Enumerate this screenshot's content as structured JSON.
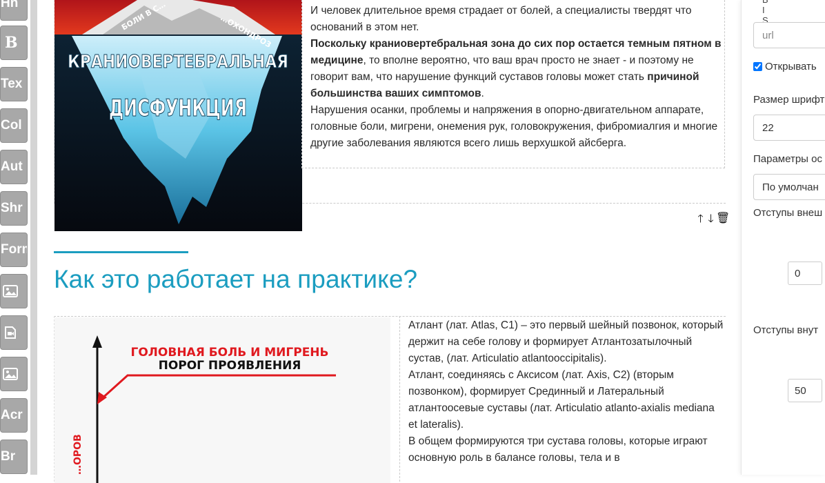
{
  "tools": [
    {
      "label": "Hn",
      "kind": "text"
    },
    {
      "label": "B",
      "kind": "serif"
    },
    {
      "label": "Tex",
      "kind": "text"
    },
    {
      "label": "Col",
      "kind": "text"
    },
    {
      "label": "Aut",
      "kind": "text"
    },
    {
      "label": "Shr",
      "kind": "text"
    },
    {
      "label": "Form",
      "kind": "text"
    },
    {
      "label": "",
      "kind": "image-icon"
    },
    {
      "label": "",
      "kind": "video-icon"
    },
    {
      "label": "",
      "kind": "image-icon"
    },
    {
      "label": "Acr",
      "kind": "text"
    },
    {
      "label": "Br",
      "kind": "text"
    }
  ],
  "block1": {
    "image_caption_top": "БОЛИ В С…",
    "image_caption_top2": "…ОХОНДРОЗ",
    "image_title_line1": "КРАНИОВЕРТЕБРАЛЬНАЯ",
    "image_title_line2": "ДИСФУНКЦИЯ",
    "p1": "И человек длительное время страдает от болей, а специалисты твердят что оснований в этом нет.",
    "p2_bold1": "Поскольку краниовертебральная зона до сих пор остается темным пятном в медицине",
    "p2_mid": ", то вполне вероятно, что ваш врач просто не знает - и поэтому не говорит вам, что нарушение функций суставов головы может стать ",
    "p2_bold2": "причиной большинства ваших симптомов",
    "p2_end": ".",
    "p3": "Нарушения осанки, проблемы и напряжения в опорно-двигательном аппарате, головные боли, мигрени, онемения рук, головокружения, фибромиалгия и многие другие заболевания являются всего лишь верхушкой айсберга."
  },
  "controls": {
    "up": "🡑",
    "down": "🡓",
    "delete": "🗑"
  },
  "heading": "Как это работает на практике?",
  "block2": {
    "img_title1": "ГОЛОВНАЯ БОЛЬ И МИГРЕНЬ",
    "img_title2": "ПОРОГ ПРОЯВЛЕНИЯ",
    "img_axis": "…ОРОВ",
    "p1": "Атлант (лат. Atlas, C1) – это первый шейный позвонок, который держит на себе голову и формирует Атлантозатылочный сустав, (лат. Articulatio atlantooccipitalis).",
    "p2": "Атлант, соединяясь с Аксисом (лат. Axis, C2) (вторым позвонком), формирует Срединный и Латеральный атлантоосевые суставы (лат. Articulatio atlanto-axialis mediana et lateralis).",
    "p3": "В общем формируются три сустава головы, которые играют основную роль в балансе головы, тела и в"
  },
  "panel": {
    "top_fragments": "B I S",
    "url_placeholder": "url",
    "open_checkbox_label": "Открывать",
    "open_checked": true,
    "font_size_label": "Размер шрифт",
    "font_size_value": "22",
    "params_label": "Параметры ос",
    "params_value": "По умолчан",
    "outer_margin_label": "Отступы внеш",
    "outer_margin_value": "0",
    "inner_padding_label": "Отступы внут",
    "inner_padding_value": "50"
  }
}
